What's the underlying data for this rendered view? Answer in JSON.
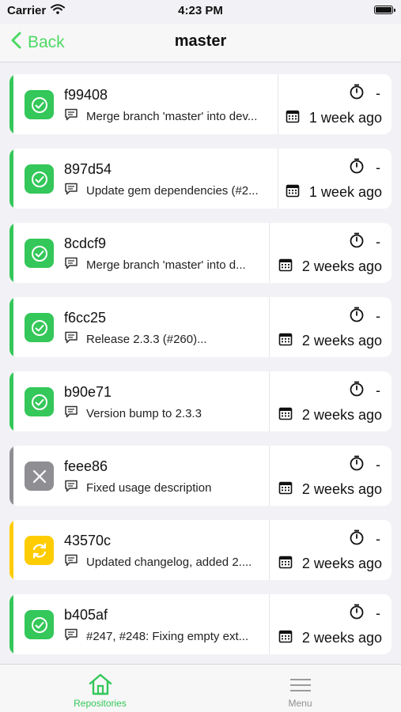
{
  "status_bar": {
    "carrier": "Carrier",
    "time": "4:23 PM"
  },
  "nav": {
    "back_label": "Back",
    "title": "master"
  },
  "colors": {
    "success": "#34c759",
    "cancelled": "#8e8e93",
    "running": "#ffcc00",
    "tint": "#4cd964"
  },
  "commits": [
    {
      "sha": "f99408",
      "message": "Merge branch 'master' into dev...",
      "duration": "-",
      "date": "1 week ago",
      "status": "success"
    },
    {
      "sha": "897d54",
      "message": "Update gem dependencies (#2...",
      "duration": "-",
      "date": "1 week ago",
      "status": "success"
    },
    {
      "sha": "8cdcf9",
      "message": "Merge branch 'master' into d...",
      "duration": "-",
      "date": "2 weeks ago",
      "status": "success"
    },
    {
      "sha": "f6cc25",
      "message": "Release 2.3.3 (#260)...",
      "duration": "-",
      "date": "2 weeks ago",
      "status": "success"
    },
    {
      "sha": "b90e71",
      "message": "Version bump to 2.3.3",
      "duration": "-",
      "date": "2 weeks ago",
      "status": "success"
    },
    {
      "sha": "feee86",
      "message": "Fixed usage description",
      "duration": "-",
      "date": "2 weeks ago",
      "status": "cancelled"
    },
    {
      "sha": "43570c",
      "message": "Updated changelog, added 2....",
      "duration": "-",
      "date": "2 weeks ago",
      "status": "running"
    },
    {
      "sha": "b405af",
      "message": "#247, #248: Fixing empty ext...",
      "duration": "-",
      "date": "2 weeks ago",
      "status": "success"
    }
  ],
  "tabs": [
    {
      "label": "Repositories",
      "icon": "home-icon",
      "active": true
    },
    {
      "label": "Menu",
      "icon": "menu-icon",
      "active": false
    }
  ]
}
